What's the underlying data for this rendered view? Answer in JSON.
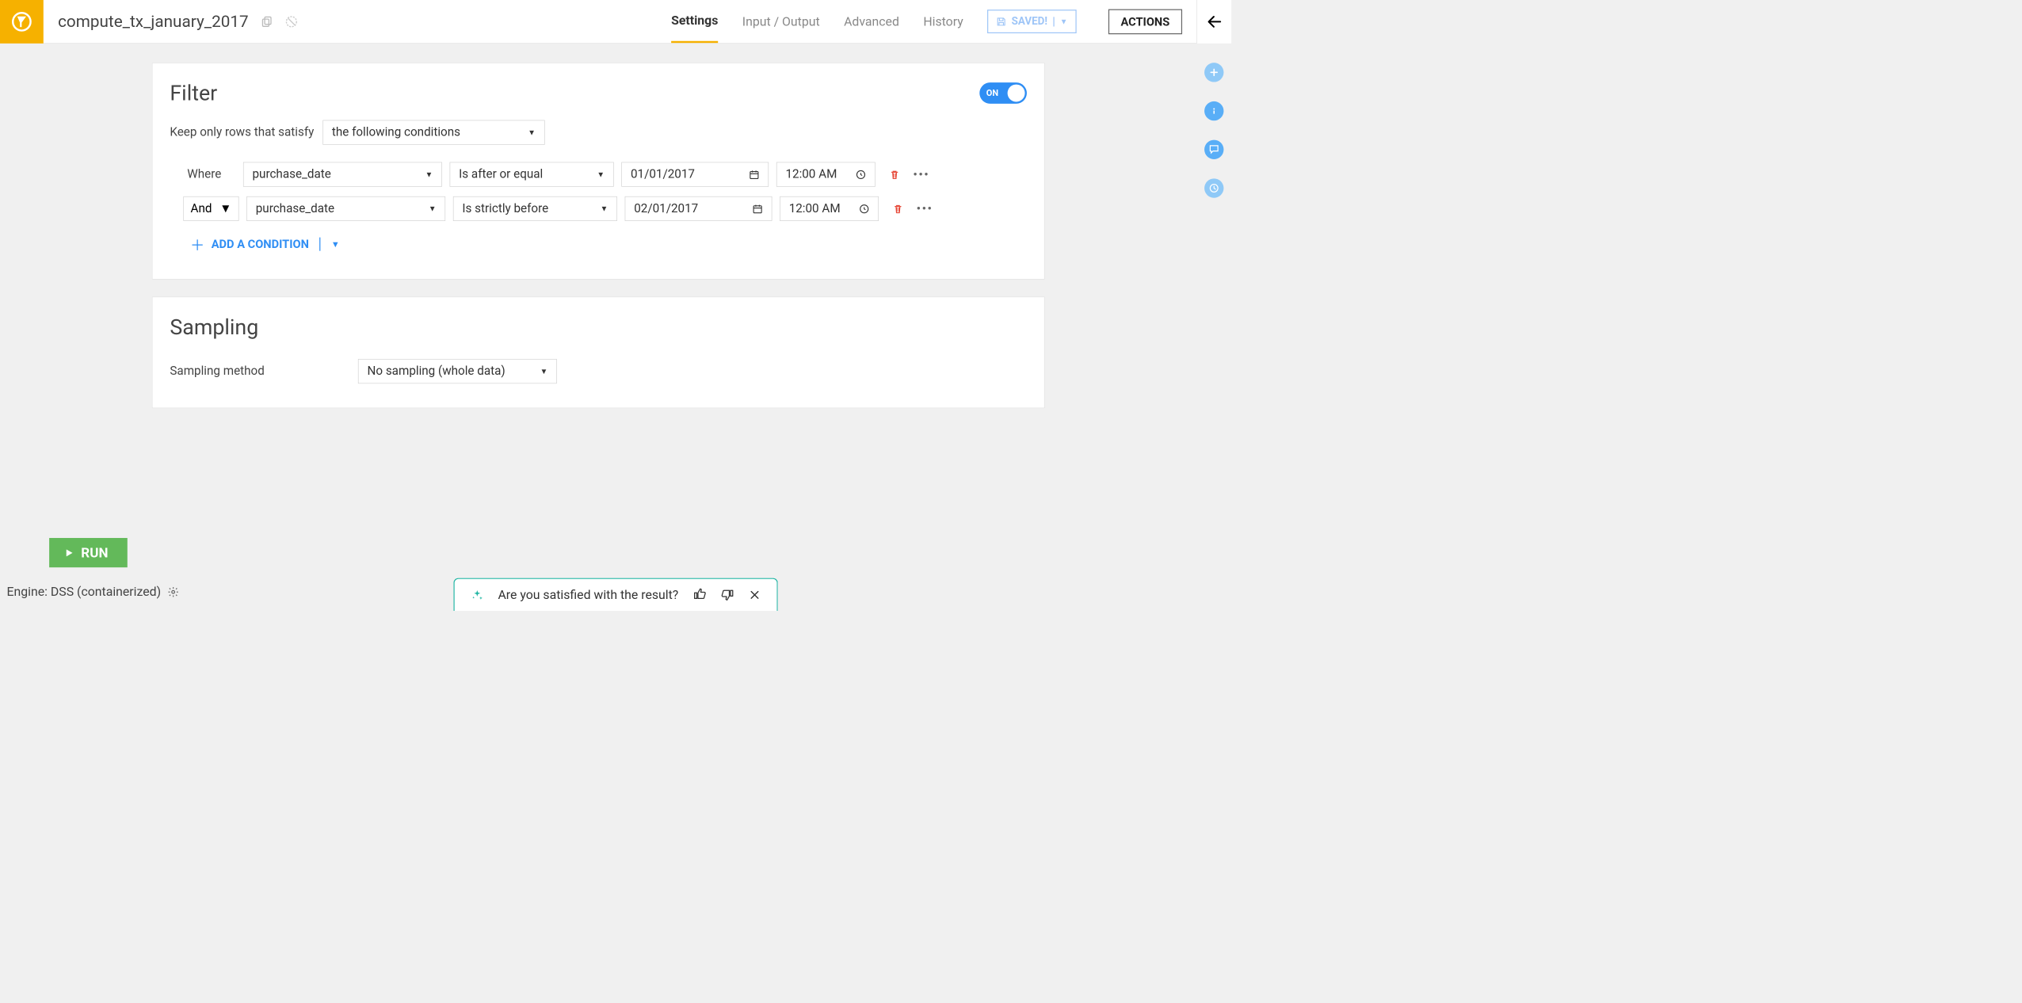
{
  "header": {
    "title": "compute_tx_january_2017",
    "tabs": [
      "Settings",
      "Input / Output",
      "Advanced",
      "History"
    ],
    "active_tab": "Settings",
    "saved_label": "SAVED!",
    "actions_label": "ACTIONS"
  },
  "filter": {
    "title": "Filter",
    "toggle_label": "ON",
    "intro_text": "Keep only rows that satisfy",
    "mode": "the following conditions",
    "where_label": "Where",
    "and_label": "And",
    "conditions": [
      {
        "column": "purchase_date",
        "operator": "Is after or equal",
        "date": "01/01/2017",
        "time": "12:00 AM"
      },
      {
        "column": "purchase_date",
        "operator": "Is strictly before",
        "date": "02/01/2017",
        "time": "12:00 AM"
      }
    ],
    "add_condition_label": "ADD A CONDITION"
  },
  "sampling": {
    "title": "Sampling",
    "method_label": "Sampling method",
    "method_value": "No sampling (whole data)"
  },
  "footer": {
    "run_label": "RUN",
    "engine_prefix": "Engine: ",
    "engine_value": "DSS (containerized)"
  },
  "feedback": {
    "question": "Are you satisfied with the result?"
  }
}
